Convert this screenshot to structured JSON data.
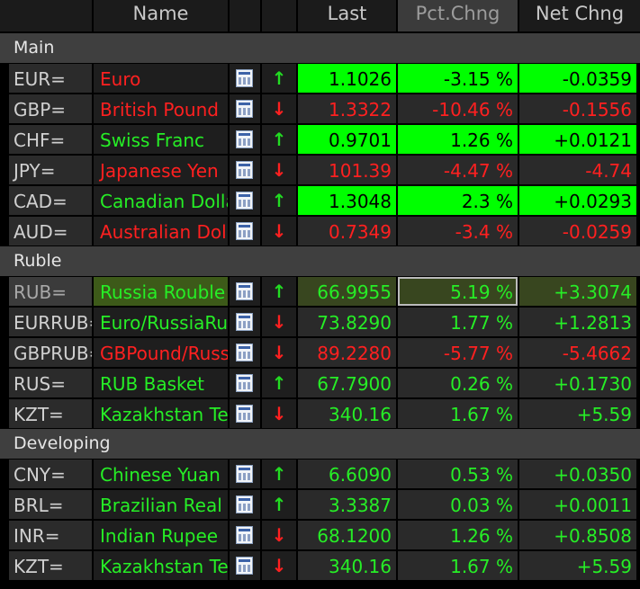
{
  "header": {
    "name": "Name",
    "last": "Last",
    "pct": "Pct.Chng",
    "net": "Net Chng"
  },
  "groups": [
    {
      "label": "Main",
      "rows": [
        {
          "ric": "EUR=",
          "name": "Euro",
          "dir": "up",
          "last": "1.1026",
          "pct": "-3.15 %",
          "net": "-0.0359",
          "name_color": "red",
          "value_color": "bright"
        },
        {
          "ric": "GBP=",
          "name": "British Pound",
          "dir": "down",
          "last": "1.3322",
          "pct": "-10.46 %",
          "net": "-0.1556",
          "name_color": "red",
          "value_color": "red"
        },
        {
          "ric": "CHF=",
          "name": "Swiss Franc",
          "dir": "up",
          "last": "0.9701",
          "pct": "1.26 %",
          "net": "+0.0121",
          "name_color": "green",
          "value_color": "bright"
        },
        {
          "ric": "JPY=",
          "name": "Japanese Yen",
          "dir": "down",
          "last": "101.39",
          "pct": "-4.47 %",
          "net": "-4.74",
          "name_color": "red",
          "value_color": "red"
        },
        {
          "ric": "CAD=",
          "name": "Canadian Dollar",
          "dir": "up",
          "last": "1.3048",
          "pct": "2.3 %",
          "net": "+0.0293",
          "name_color": "green",
          "value_color": "bright"
        },
        {
          "ric": "AUD=",
          "name": "Australian Dollar",
          "dir": "down",
          "last": "0.7349",
          "pct": "-3.4 %",
          "net": "-0.0259",
          "name_color": "red",
          "value_color": "red"
        }
      ]
    },
    {
      "label": "Ruble",
      "rows": [
        {
          "ric": "RUB=",
          "name": "Russia Rouble",
          "dir": "up",
          "last": "66.9955",
          "pct": "5.19 %",
          "net": "+3.3074",
          "name_color": "green",
          "value_color": "green",
          "selected": true
        },
        {
          "ric": "EURRUB=",
          "name": "Euro/RussiaRuble",
          "dir": "down",
          "last": "73.8290",
          "pct": "1.77 %",
          "net": "+1.2813",
          "name_color": "green",
          "value_color": "green"
        },
        {
          "ric": "GBPRUB=",
          "name": "GBPound/RussiaRuble",
          "dir": "down",
          "last": "89.2280",
          "pct": "-5.77 %",
          "net": "-5.4662",
          "name_color": "red",
          "value_color": "red"
        },
        {
          "ric": "RUS=",
          "name": "RUB Basket",
          "dir": "up",
          "last": "67.7900",
          "pct": "0.26 %",
          "net": "+0.1730",
          "name_color": "green",
          "value_color": "green"
        },
        {
          "ric": "KZT=",
          "name": "Kazakhstan Tenge",
          "dir": "down",
          "last": "340.16",
          "pct": "1.67 %",
          "net": "+5.59",
          "name_color": "green",
          "value_color": "green"
        }
      ]
    },
    {
      "label": "Developing",
      "rows": [
        {
          "ric": "CNY=",
          "name": "Chinese Yuan",
          "dir": "up",
          "last": "6.6090",
          "pct": "0.53 %",
          "net": "+0.0350",
          "name_color": "green",
          "value_color": "green"
        },
        {
          "ric": "BRL=",
          "name": "Brazilian Real",
          "dir": "up",
          "last": "3.3387",
          "pct": "0.03 %",
          "net": "+0.0011",
          "name_color": "green",
          "value_color": "green"
        },
        {
          "ric": "INR=",
          "name": "Indian Rupee",
          "dir": "down",
          "last": "68.1200",
          "pct": "1.26 %",
          "net": "+0.8508",
          "name_color": "green",
          "value_color": "green"
        },
        {
          "ric": "KZT=",
          "name": "Kazakhstan Tenge",
          "dir": "down",
          "last": "340.16",
          "pct": "1.67 %",
          "net": "+5.59",
          "name_color": "green",
          "value_color": "green"
        }
      ]
    }
  ],
  "icons": {
    "quote": "quote-page-icon",
    "up": "up-arrow-icon",
    "down": "down-arrow-icon"
  },
  "colors": {
    "green": "#26ee26",
    "red": "#ff2020",
    "bright_green": "#00ff00",
    "group_bar": "#3f3f3f"
  }
}
